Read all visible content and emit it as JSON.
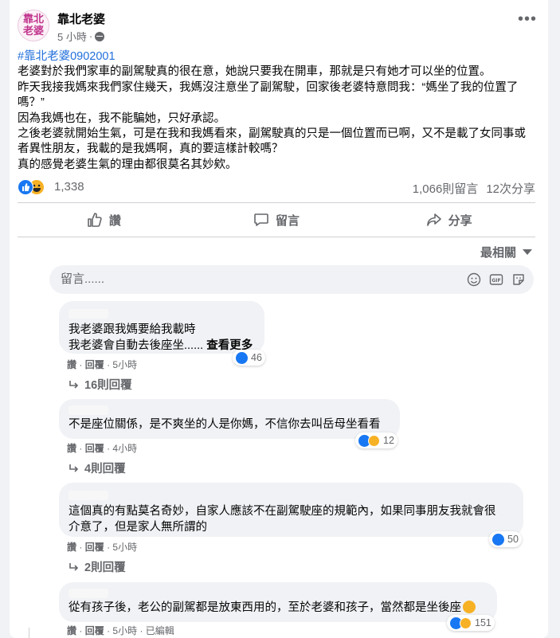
{
  "post": {
    "page_name": "靠北老婆",
    "avatar_text_top": "靠北",
    "avatar_text_bottom": "老婆",
    "time": "5 小時",
    "separator": "·",
    "more_label": "•••",
    "hashtag": "#靠北老婆0902001",
    "lines": [
      "老婆對於我們家車的副駕駛真的很在意，她說只要我在開車，那就是只有她才可以坐的位置。",
      "昨天我接我媽來我們家住幾天，我媽沒注意坐了副駕駛，回家後老婆特意問我：“媽坐了我的位置了嗎？”",
      "因為我媽也在，我不能騙她，只好承認。",
      "之後老婆就開始生氣，可是在我和我媽看來，副駕駛真的只是一個位置而已啊，又不是載了女同事或者異性朋友，我載的是我媽啊，真的要這樣計較嗎？",
      "真的感覺老婆生氣的理由都很莫名其妙欸。"
    ],
    "reaction_count": "1,338",
    "comment_count": "1,066則留言",
    "share_count": "12次分享"
  },
  "actions": {
    "like": "讚",
    "comment": "留言",
    "share": "分享"
  },
  "sort_label": "最相關",
  "composer": {
    "placeholder": "留言......"
  },
  "comments": [
    {
      "line1": "我老婆跟我媽要給我載時",
      "line2": "我老婆會自動去後座坐......",
      "see_more": "查看更多",
      "like": "讚",
      "dot": "·",
      "reply": "回覆",
      "time": "5小時",
      "reactions": "46",
      "replies": "16則回覆"
    },
    {
      "line1": "不是座位關係，是不爽坐的人是你媽，不信你去叫岳母坐看看",
      "like": "讚",
      "dot": "·",
      "reply": "回覆",
      "time": "4小時",
      "reactions": "12",
      "replies": "4則回覆"
    },
    {
      "line1": "這個真的有點莫名奇妙，自家人應該不在副駕駛座的規範內，如果同事朋友我就會很",
      "line2": "介意了，但是家人無所謂的",
      "like": "讚",
      "dot": "·",
      "reply": "回覆",
      "time": "5小時",
      "reactions": "50",
      "replies": "2則回覆"
    },
    {
      "line1": "從有孩子後，老公的副駕都是放東西用的，至於老婆和孩子，當然都是坐後座",
      "like": "讚",
      "dot": "·",
      "reply": "回覆",
      "time": "5小時",
      "edited": "已編輯",
      "reactions": "151"
    }
  ],
  "colors": {
    "link": "#216fdb",
    "like_blue": "#1877f2",
    "haha_yellow": "#f7b125",
    "muted": "#65676b",
    "bubble": "#f0f2f5"
  }
}
